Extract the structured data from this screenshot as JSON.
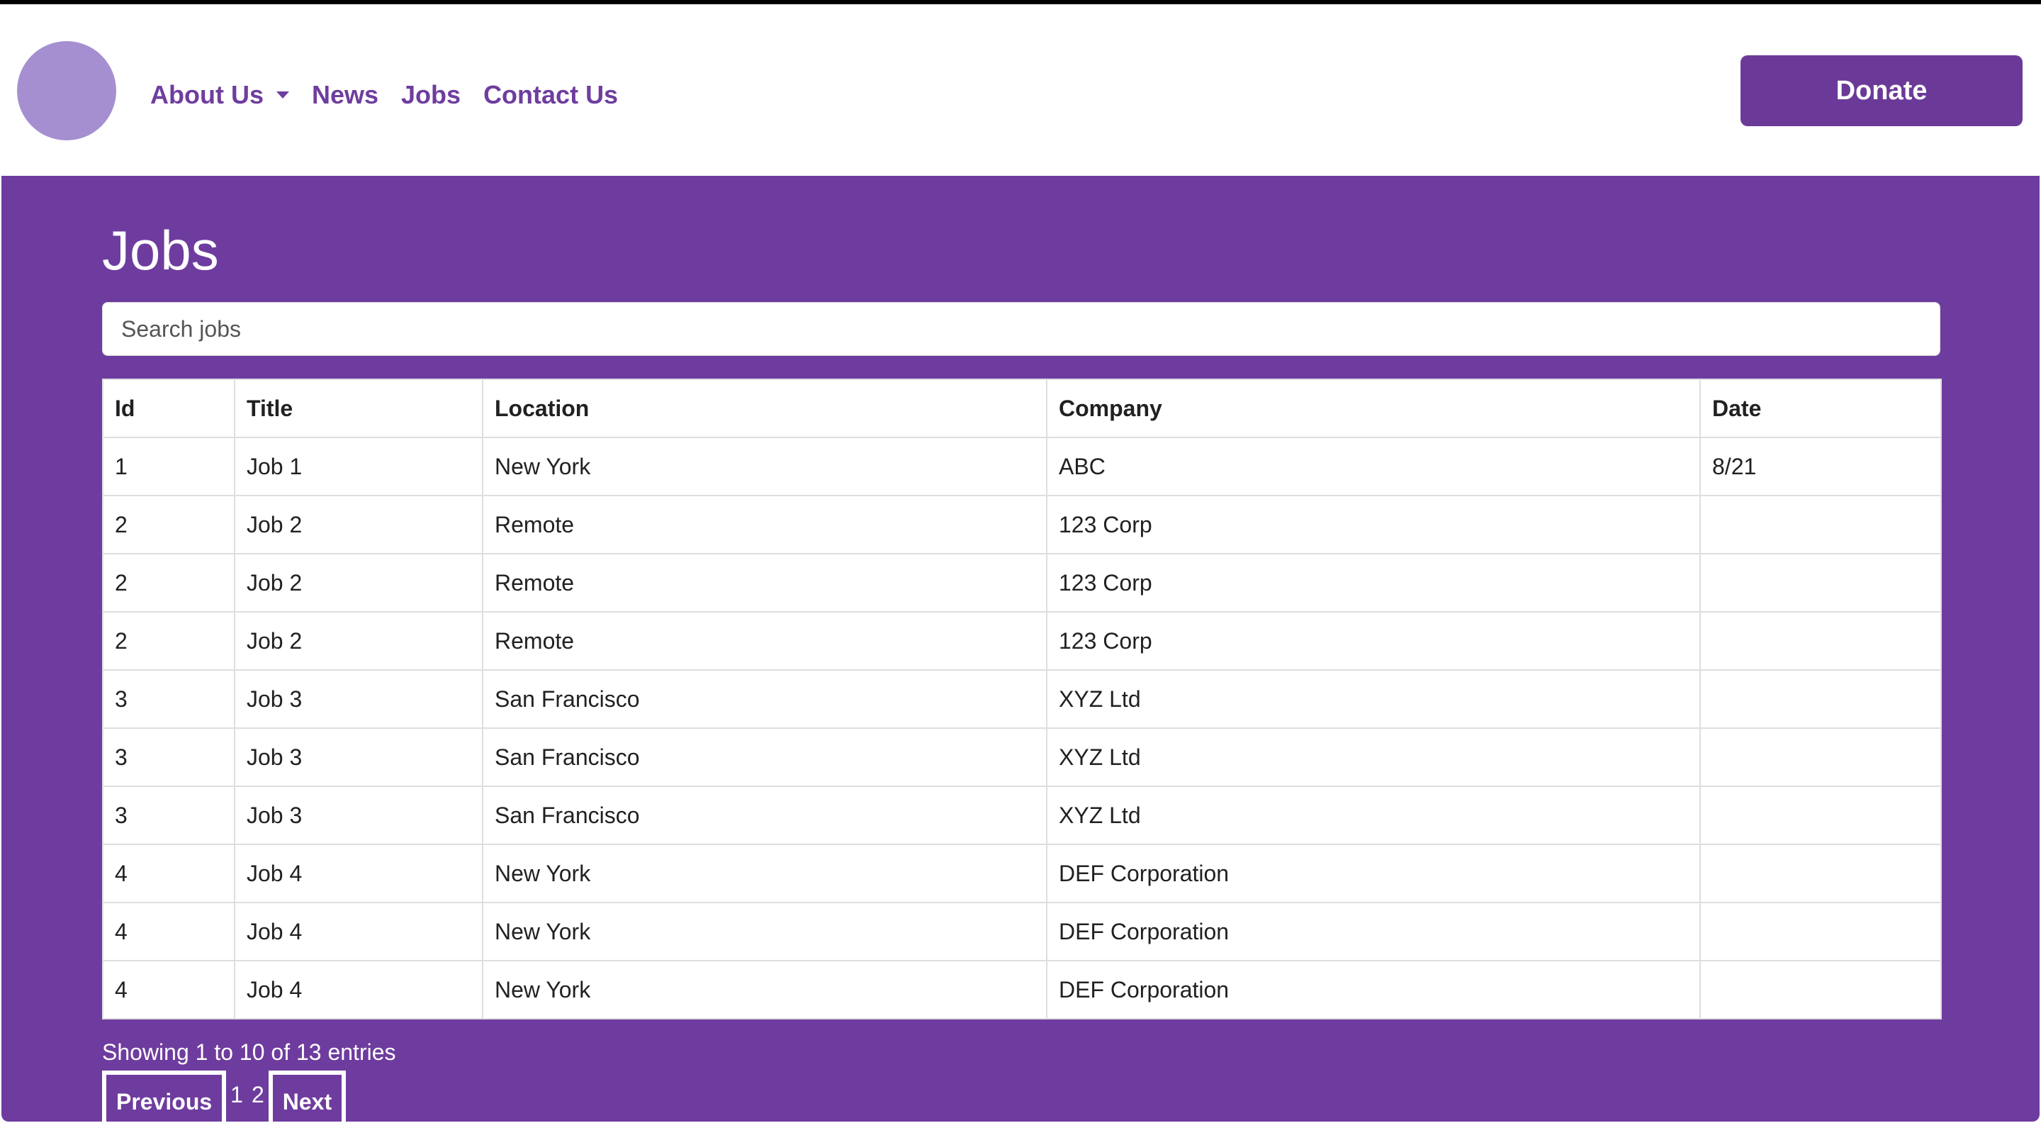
{
  "nav": {
    "about_label": "About Us",
    "news_label": "News",
    "jobs_label": "Jobs",
    "contact_label": "Contact Us",
    "donate_label": "Donate"
  },
  "page": {
    "title": "Jobs",
    "search_placeholder": "Search jobs"
  },
  "table": {
    "columns": [
      "Id",
      "Title",
      "Location",
      "Company",
      "Date"
    ],
    "rows": [
      [
        "1",
        "Job 1",
        "New York",
        "ABC",
        "8/21"
      ],
      [
        "2",
        "Job 2",
        "Remote",
        "123 Corp",
        ""
      ],
      [
        "2",
        "Job 2",
        "Remote",
        "123 Corp",
        ""
      ],
      [
        "2",
        "Job 2",
        "Remote",
        "123 Corp",
        ""
      ],
      [
        "3",
        "Job 3",
        "San Francisco",
        "XYZ Ltd",
        ""
      ],
      [
        "3",
        "Job 3",
        "San Francisco",
        "XYZ Ltd",
        ""
      ],
      [
        "3",
        "Job 3",
        "San Francisco",
        "XYZ Ltd",
        ""
      ],
      [
        "4",
        "Job 4",
        "New York",
        "DEF Corporation",
        ""
      ],
      [
        "4",
        "Job 4",
        "New York",
        "DEF Corporation",
        ""
      ],
      [
        "4",
        "Job 4",
        "New York",
        "DEF Corporation",
        ""
      ]
    ]
  },
  "pagination": {
    "info": "Showing 1 to 10 of 13 entries",
    "previous_label": "Previous",
    "pages": [
      "1",
      "2"
    ],
    "next_label": "Next"
  },
  "colors": {
    "brand": "#6e3c9e",
    "link": "#6f3d9e",
    "logo": "#a58fd1"
  }
}
